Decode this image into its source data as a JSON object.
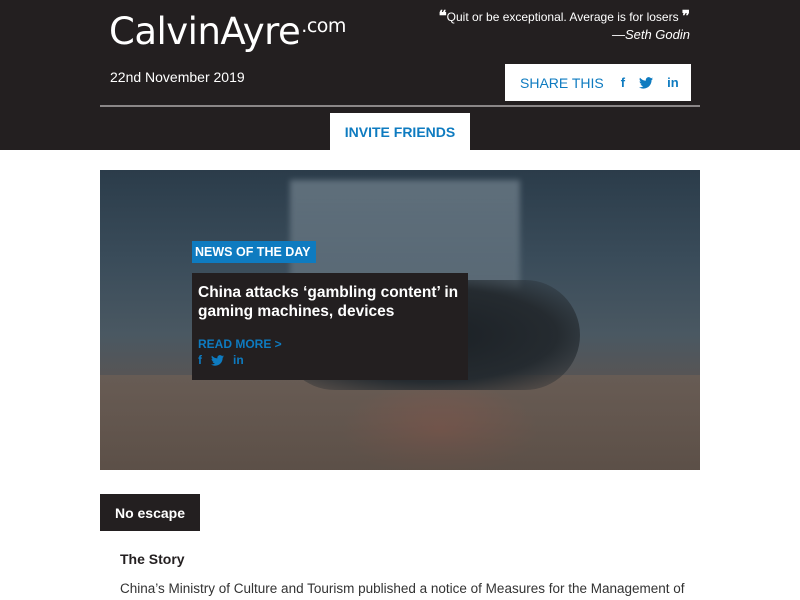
{
  "header": {
    "logo_main": "CalvinAyre",
    "logo_suffix": ".com",
    "date": "22nd November 2019",
    "quote_text": "Quit or be exceptional. Average is for losers",
    "quote_author": "—Seth Godin",
    "share_label": "SHARE THIS",
    "invite_label": "INVITE FRIENDS"
  },
  "hero": {
    "tag": "NEWS OF THE DAY",
    "title": "China attacks ‘gambling content’ in gaming machines, devices",
    "read_more": "READ MORE >"
  },
  "icons": {
    "facebook": "f",
    "linkedin": "in"
  },
  "article": {
    "section_tag": "No escape",
    "heading": "The Story",
    "body": "China’s Ministry of Culture and Tourism published a notice of Measures for the Management of"
  },
  "colors": {
    "brand_dark": "#231f20",
    "accent_blue": "#0e7bc0"
  }
}
